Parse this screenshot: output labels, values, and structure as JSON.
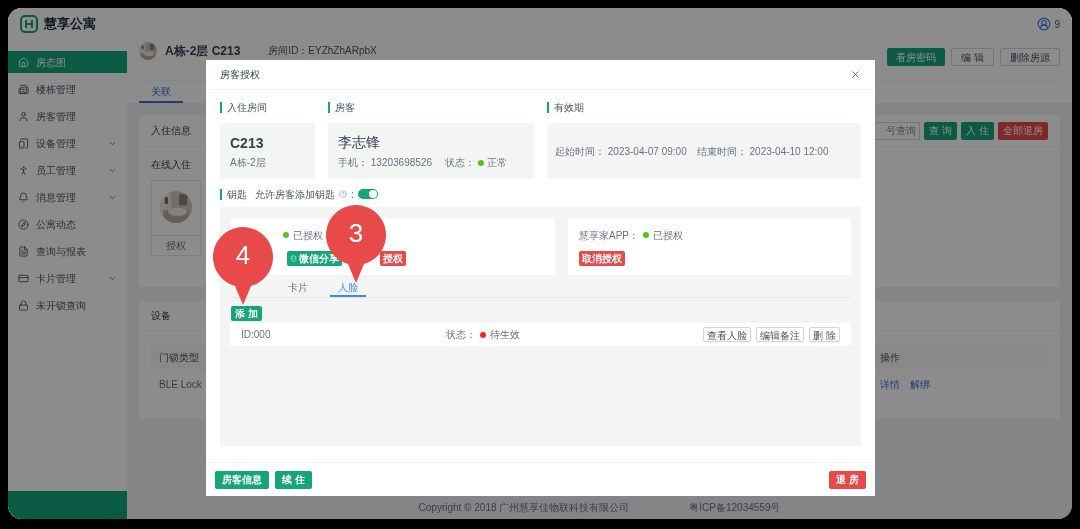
{
  "app": {
    "logo_text": "慧享公寓",
    "user_badge": "9"
  },
  "sidebar": {
    "items": [
      {
        "label": "房态图",
        "selected": true,
        "expandable": false
      },
      {
        "label": "楼栋管理",
        "selected": false,
        "expandable": false
      },
      {
        "label": "房客管理",
        "selected": false,
        "expandable": false
      },
      {
        "label": "设备管理",
        "selected": false,
        "expandable": true
      },
      {
        "label": "员工管理",
        "selected": false,
        "expandable": true
      },
      {
        "label": "消息管理",
        "selected": false,
        "expandable": true
      },
      {
        "label": "公寓动态",
        "selected": false,
        "expandable": false
      },
      {
        "label": "查询与报表",
        "selected": false,
        "expandable": false
      },
      {
        "label": "卡片管理",
        "selected": false,
        "expandable": true
      },
      {
        "label": "未开锁查询",
        "selected": false,
        "expandable": false
      }
    ]
  },
  "room": {
    "title": "A栋-2层 C213",
    "room_id": "房间ID：EYZhZhARpbX",
    "actions": [
      {
        "label": "看房密码",
        "kind": "primary"
      },
      {
        "label": "编 辑",
        "kind": "default"
      },
      {
        "label": "删除房源",
        "kind": "default"
      }
    ],
    "tabs": [
      {
        "label": "关联",
        "selected": true
      }
    ]
  },
  "checkin": {
    "title": "入住信息",
    "search_placeholder": "号查询",
    "buttons": [
      {
        "label": "查 询",
        "kind": "primary"
      },
      {
        "label": "入 住",
        "kind": "primary"
      },
      {
        "label": "全部退房",
        "kind": "danger"
      }
    ],
    "subtitle": "在线入住",
    "authorize_button": "授权"
  },
  "devices": {
    "title": "设备",
    "columns": [
      "门锁类型",
      "操作"
    ],
    "rows": [
      {
        "lock_type": "BLE Lock",
        "links": [
          "详情",
          "解绑"
        ]
      }
    ]
  },
  "footer": {
    "copyright": "Copyright © 2018 广州慧享佳物联科技有限公司",
    "icp": "粤ICP备12034559号"
  },
  "modal": {
    "title": "房客授权",
    "room": {
      "heading": "入住房间",
      "number": "C213",
      "floor": "A栋-2层"
    },
    "guest": {
      "heading": "房客",
      "name": "李志锋",
      "phone": "手机： 13203698526",
      "status_label": "状态：",
      "status": "正常",
      "color": "#52c41a"
    },
    "validity": {
      "heading": "有效期",
      "start": "起始时间： 2023-04-07 09:00",
      "end": "结束时间： 2023-04-10 12:00"
    },
    "keys": {
      "heading": "钥匙",
      "allow_label": "允许房客添加钥匙",
      "colon": ":",
      "allow_on": true
    },
    "key_cards": [
      {
        "status": "已授权",
        "color": "#52c41a",
        "buttons": [
          {
            "label": "微信分享",
            "kind": "share"
          },
          {
            "label": "授权",
            "kind": "danger"
          }
        ]
      },
      {
        "label": "慧享家APP：",
        "status": "已授权",
        "color": "#52c41a",
        "buttons": [
          {
            "label": "取消授权",
            "kind": "danger"
          }
        ]
      }
    ],
    "tabs": [
      {
        "label": "卡片",
        "selected": false
      },
      {
        "label": "人脸",
        "selected": true
      }
    ],
    "add_button": "添 加",
    "faces": [
      {
        "id": "ID:000",
        "status_label": "状态：",
        "status": "待生效",
        "color": "#f5222d",
        "actions": [
          "查看人脸",
          "编辑备注",
          "删 除"
        ]
      }
    ],
    "footer_buttons": [
      {
        "label": "房客信息",
        "kind": "primary"
      },
      {
        "label": "续 住",
        "kind": "primary"
      },
      {
        "label": "退 房",
        "kind": "danger"
      }
    ]
  },
  "markers": [
    {
      "label": "4"
    },
    {
      "label": "3"
    }
  ]
}
